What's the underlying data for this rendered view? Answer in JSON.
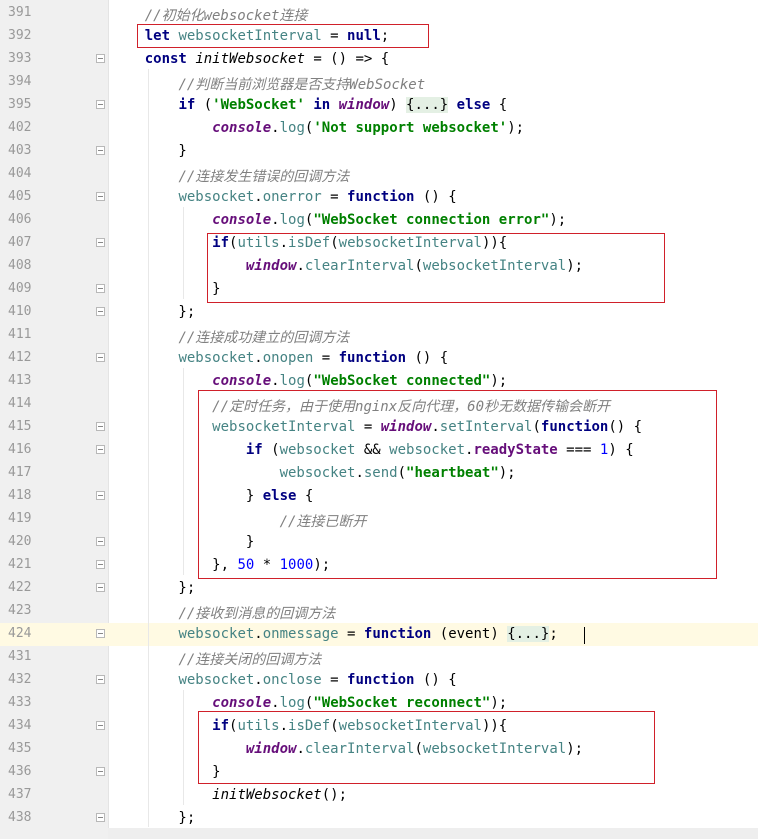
{
  "editor": {
    "lines": [
      {
        "num": "391",
        "fold": false,
        "tokens": [
          {
            "t": "    "
          },
          {
            "t": "//初始化websocket连接",
            "c": "cmt"
          }
        ]
      },
      {
        "num": "392",
        "fold": false,
        "tokens": [
          {
            "t": "    "
          },
          {
            "t": "let",
            "c": "kw"
          },
          {
            "t": " "
          },
          {
            "t": "websocketInterval",
            "c": "prop"
          },
          {
            "t": " = "
          },
          {
            "t": "null",
            "c": "kw"
          },
          {
            "t": ";"
          }
        ]
      },
      {
        "num": "393",
        "fold": true,
        "tokens": [
          {
            "t": "    "
          },
          {
            "t": "const",
            "c": "kw"
          },
          {
            "t": " "
          },
          {
            "t": "initWebsocket",
            "c": "fn"
          },
          {
            "t": " = () => {"
          }
        ]
      },
      {
        "num": "394",
        "fold": false,
        "tokens": [
          {
            "t": "        "
          },
          {
            "t": "//判断当前浏览器是否支持WebSocket",
            "c": "cmt"
          }
        ]
      },
      {
        "num": "395",
        "fold": true,
        "tokens": [
          {
            "t": "        "
          },
          {
            "t": "if",
            "c": "kw"
          },
          {
            "t": " ("
          },
          {
            "t": "'WebSocket'",
            "c": "str"
          },
          {
            "t": " "
          },
          {
            "t": "in",
            "c": "kw"
          },
          {
            "t": " "
          },
          {
            "t": "window",
            "c": "gvar"
          },
          {
            "t": ") "
          },
          {
            "t": "{...}",
            "c": "fold-ph"
          },
          {
            "t": " "
          },
          {
            "t": "else",
            "c": "kw"
          },
          {
            "t": " {"
          }
        ]
      },
      {
        "num": "402",
        "fold": false,
        "tokens": [
          {
            "t": "            "
          },
          {
            "t": "console",
            "c": "gvar"
          },
          {
            "t": "."
          },
          {
            "t": "log",
            "c": "prop"
          },
          {
            "t": "("
          },
          {
            "t": "'Not support websocket'",
            "c": "str"
          },
          {
            "t": ");"
          }
        ]
      },
      {
        "num": "403",
        "fold": true,
        "tokens": [
          {
            "t": "        }"
          }
        ]
      },
      {
        "num": "404",
        "fold": false,
        "tokens": [
          {
            "t": "        "
          },
          {
            "t": "//连接发生错误的回调方法",
            "c": "cmt"
          }
        ]
      },
      {
        "num": "405",
        "fold": true,
        "tokens": [
          {
            "t": "        "
          },
          {
            "t": "websocket",
            "c": "prop"
          },
          {
            "t": "."
          },
          {
            "t": "onerror",
            "c": "prop"
          },
          {
            "t": " = "
          },
          {
            "t": "function",
            "c": "kw"
          },
          {
            "t": " () {"
          }
        ]
      },
      {
        "num": "406",
        "fold": false,
        "tokens": [
          {
            "t": "            "
          },
          {
            "t": "console",
            "c": "gvar"
          },
          {
            "t": "."
          },
          {
            "t": "log",
            "c": "prop"
          },
          {
            "t": "("
          },
          {
            "t": "\"WebSocket connection error\"",
            "c": "str"
          },
          {
            "t": ");"
          }
        ]
      },
      {
        "num": "407",
        "fold": true,
        "tokens": [
          {
            "t": "            "
          },
          {
            "t": "if",
            "c": "kw"
          },
          {
            "t": "("
          },
          {
            "t": "utils",
            "c": "prop"
          },
          {
            "t": "."
          },
          {
            "t": "isDef",
            "c": "prop"
          },
          {
            "t": "("
          },
          {
            "t": "websocketInterval",
            "c": "prop"
          },
          {
            "t": ")){"
          }
        ]
      },
      {
        "num": "408",
        "fold": false,
        "tokens": [
          {
            "t": "                "
          },
          {
            "t": "window",
            "c": "gvar"
          },
          {
            "t": "."
          },
          {
            "t": "clearInterval",
            "c": "prop"
          },
          {
            "t": "("
          },
          {
            "t": "websocketInterval",
            "c": "prop"
          },
          {
            "t": ");"
          }
        ]
      },
      {
        "num": "409",
        "fold": true,
        "tokens": [
          {
            "t": "            }"
          }
        ]
      },
      {
        "num": "410",
        "fold": true,
        "tokens": [
          {
            "t": "        };"
          }
        ]
      },
      {
        "num": "411",
        "fold": false,
        "tokens": [
          {
            "t": "        "
          },
          {
            "t": "//连接成功建立的回调方法",
            "c": "cmt"
          }
        ]
      },
      {
        "num": "412",
        "fold": true,
        "tokens": [
          {
            "t": "        "
          },
          {
            "t": "websocket",
            "c": "prop"
          },
          {
            "t": "."
          },
          {
            "t": "onopen",
            "c": "prop"
          },
          {
            "t": " = "
          },
          {
            "t": "function",
            "c": "kw"
          },
          {
            "t": " () {"
          }
        ]
      },
      {
        "num": "413",
        "fold": false,
        "tokens": [
          {
            "t": "            "
          },
          {
            "t": "console",
            "c": "gvar"
          },
          {
            "t": "."
          },
          {
            "t": "log",
            "c": "prop"
          },
          {
            "t": "("
          },
          {
            "t": "\"WebSocket connected\"",
            "c": "str"
          },
          {
            "t": ");"
          }
        ]
      },
      {
        "num": "414",
        "fold": false,
        "tokens": [
          {
            "t": "            "
          },
          {
            "t": "//定时任务，由于使用nginx反向代理，60秒无数据传输会断开",
            "c": "cmt"
          }
        ]
      },
      {
        "num": "415",
        "fold": true,
        "tokens": [
          {
            "t": "            "
          },
          {
            "t": "websocketInterval",
            "c": "prop"
          },
          {
            "t": " = "
          },
          {
            "t": "window",
            "c": "gvar"
          },
          {
            "t": "."
          },
          {
            "t": "setInterval",
            "c": "prop"
          },
          {
            "t": "("
          },
          {
            "t": "function",
            "c": "kw"
          },
          {
            "t": "() {"
          }
        ]
      },
      {
        "num": "416",
        "fold": true,
        "tokens": [
          {
            "t": "                "
          },
          {
            "t": "if",
            "c": "kw"
          },
          {
            "t": " ("
          },
          {
            "t": "websocket",
            "c": "prop"
          },
          {
            "t": " && "
          },
          {
            "t": "websocket",
            "c": "prop"
          },
          {
            "t": "."
          },
          {
            "t": "readyState",
            "c": "field"
          },
          {
            "t": " === "
          },
          {
            "t": "1",
            "c": "num"
          },
          {
            "t": ") {"
          }
        ]
      },
      {
        "num": "417",
        "fold": false,
        "tokens": [
          {
            "t": "                    "
          },
          {
            "t": "websocket",
            "c": "prop"
          },
          {
            "t": "."
          },
          {
            "t": "send",
            "c": "prop"
          },
          {
            "t": "("
          },
          {
            "t": "\"heartbeat\"",
            "c": "str"
          },
          {
            "t": ");"
          }
        ]
      },
      {
        "num": "418",
        "fold": true,
        "tokens": [
          {
            "t": "                } "
          },
          {
            "t": "else",
            "c": "kw"
          },
          {
            "t": " {"
          }
        ]
      },
      {
        "num": "419",
        "fold": false,
        "tokens": [
          {
            "t": "                    "
          },
          {
            "t": "//连接已断开",
            "c": "cmt"
          }
        ]
      },
      {
        "num": "420",
        "fold": true,
        "tokens": [
          {
            "t": "                }"
          }
        ]
      },
      {
        "num": "421",
        "fold": true,
        "tokens": [
          {
            "t": "            }, "
          },
          {
            "t": "50",
            "c": "num"
          },
          {
            "t": " * "
          },
          {
            "t": "1000",
            "c": "num"
          },
          {
            "t": ");"
          }
        ]
      },
      {
        "num": "422",
        "fold": true,
        "tokens": [
          {
            "t": "        };"
          }
        ]
      },
      {
        "num": "423",
        "fold": false,
        "tokens": [
          {
            "t": "        "
          },
          {
            "t": "//接收到消息的回调方法",
            "c": "cmt"
          }
        ]
      },
      {
        "num": "424",
        "fold": true,
        "current": true,
        "tokens": [
          {
            "t": "        "
          },
          {
            "t": "websocket",
            "c": "prop"
          },
          {
            "t": "."
          },
          {
            "t": "onmessage",
            "c": "prop"
          },
          {
            "t": " = "
          },
          {
            "t": "function",
            "c": "kw"
          },
          {
            "t": " ("
          },
          {
            "t": "event",
            "c": "ident"
          },
          {
            "t": ") "
          },
          {
            "t": "{...}",
            "c": "fold-ph"
          },
          {
            "t": ";"
          }
        ]
      },
      {
        "num": "431",
        "fold": false,
        "tokens": [
          {
            "t": "        "
          },
          {
            "t": "//连接关闭的回调方法",
            "c": "cmt"
          }
        ]
      },
      {
        "num": "432",
        "fold": true,
        "tokens": [
          {
            "t": "        "
          },
          {
            "t": "websocket",
            "c": "prop"
          },
          {
            "t": "."
          },
          {
            "t": "onclose",
            "c": "prop"
          },
          {
            "t": " = "
          },
          {
            "t": "function",
            "c": "kw"
          },
          {
            "t": " () {"
          }
        ]
      },
      {
        "num": "433",
        "fold": false,
        "tokens": [
          {
            "t": "            "
          },
          {
            "t": "console",
            "c": "gvar"
          },
          {
            "t": "."
          },
          {
            "t": "log",
            "c": "prop"
          },
          {
            "t": "("
          },
          {
            "t": "\"WebSocket reconnect\"",
            "c": "str"
          },
          {
            "t": ");"
          }
        ]
      },
      {
        "num": "434",
        "fold": true,
        "tokens": [
          {
            "t": "            "
          },
          {
            "t": "if",
            "c": "kw"
          },
          {
            "t": "("
          },
          {
            "t": "utils",
            "c": "prop"
          },
          {
            "t": "."
          },
          {
            "t": "isDef",
            "c": "prop"
          },
          {
            "t": "("
          },
          {
            "t": "websocketInterval",
            "c": "prop"
          },
          {
            "t": ")){"
          }
        ]
      },
      {
        "num": "435",
        "fold": false,
        "tokens": [
          {
            "t": "                "
          },
          {
            "t": "window",
            "c": "gvar"
          },
          {
            "t": "."
          },
          {
            "t": "clearInterval",
            "c": "prop"
          },
          {
            "t": "("
          },
          {
            "t": "websocketInterval",
            "c": "prop"
          },
          {
            "t": ");"
          }
        ]
      },
      {
        "num": "436",
        "fold": true,
        "tokens": [
          {
            "t": "            }"
          }
        ]
      },
      {
        "num": "437",
        "fold": false,
        "tokens": [
          {
            "t": "            "
          },
          {
            "t": "initWebsocket",
            "c": "fn"
          },
          {
            "t": "();"
          }
        ]
      },
      {
        "num": "438",
        "fold": true,
        "tokens": [
          {
            "t": "        };"
          }
        ]
      }
    ]
  }
}
